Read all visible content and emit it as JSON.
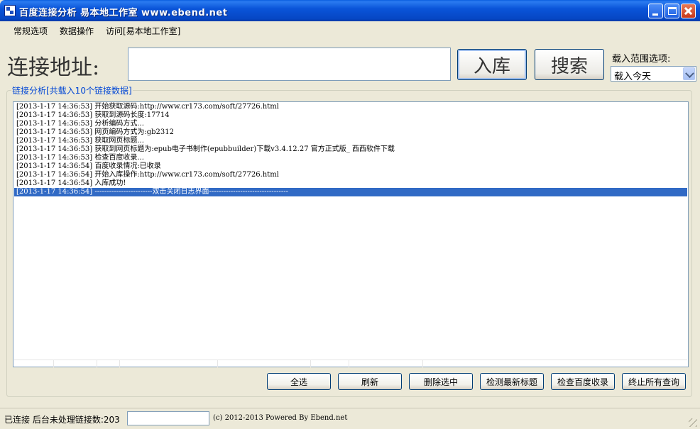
{
  "window": {
    "title": "百度连接分析  易本地工作室  www.ebend.net"
  },
  "menu": [
    "常规选项",
    "数据操作",
    "访问[易本地工作室]"
  ],
  "address": {
    "label": "连接地址:",
    "value": "",
    "import_button": "入库",
    "search_button": "搜索"
  },
  "scope": {
    "label": "载入范围选项:",
    "selected": "载入今天"
  },
  "group": {
    "title": "链接分析[共载入10个链接数据]"
  },
  "log": [
    "[2013-1-17 14:36:53] 开始获取源码:http://www.cr173.com/soft/27726.html",
    "[2013-1-17 14:36:53] 获取到源码长度:17714",
    "[2013-1-17 14:36:53] 分析编码方式...",
    "[2013-1-17 14:36:53] 网页编码方式为:gb2312",
    "[2013-1-17 14:36:53] 获取网页标题...",
    "[2013-1-17 14:36:53] 获取到网页标题为:epub电子书制作(epubbuilder)下载v3.4.12.27 官方正式版_ 西西软件下载",
    "[2013-1-17 14:36:53] 检查百度收录...",
    "[2013-1-17 14:36:54] 百度收录情况:已收录",
    "[2013-1-17 14:36:54] 开始入库操作:http://www.cr173.com/soft/27726.html",
    "[2013-1-17 14:36:54] 入库成功!",
    "[2013-1-17 14:36:54] ------------------------双击关闭日志界面---------------------------------"
  ],
  "selected_log_index": 10,
  "buttons": [
    "全选",
    "刷新",
    "删除选中",
    "检测最新标题",
    "检查百度收录",
    "终止所有查询"
  ],
  "status": {
    "text": "已连接  后台未处理链接数:203",
    "input_value": "",
    "copyright": "(c) 2012-2013 Powered By Ebend.net"
  },
  "colors": {
    "titlebar": "#0a55d9",
    "selection": "#316ac5",
    "group_title": "#0046d5",
    "face": "#ece9d8"
  }
}
